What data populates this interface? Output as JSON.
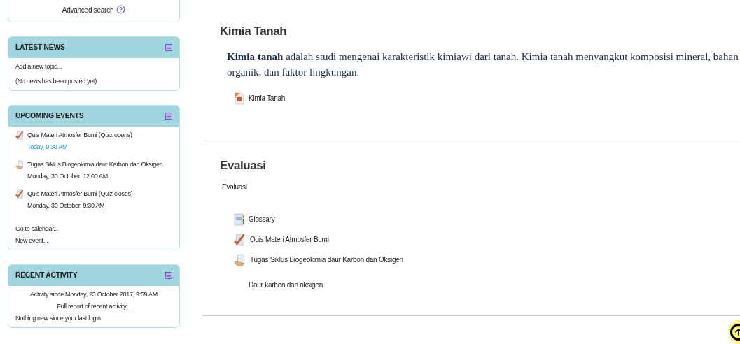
{
  "sidebar": {
    "search_link": "Advanced search",
    "blocks": [
      {
        "title": "LATEST NEWS",
        "items": [
          {
            "kind": "text",
            "text": "Add a new topic..."
          },
          {
            "kind": "text",
            "text": "(No news has been posted yet)"
          }
        ]
      },
      {
        "title": "UPCOMING EVENTS",
        "items": [
          {
            "kind": "quiz_event",
            "text": "Quis Materi Atmosfer Bumi (Quiz opens)",
            "time": "Today, 9:30 AM",
            "today": true
          },
          {
            "kind": "assignment_event",
            "text": "Tugas Siklus Biogeokimia daur Karbon dan Oksigen",
            "time": "Monday, 30 October, 12:00 AM",
            "today": false
          },
          {
            "kind": "quiz_event",
            "text": "Quis Materi Atmosfer Bumi (Quiz closes)",
            "time": "Monday, 30 October, 9:30 AM",
            "today": false
          },
          {
            "kind": "text",
            "text": "Go to calendar..."
          },
          {
            "kind": "text",
            "text": "New event..."
          }
        ]
      },
      {
        "title": "RECENT ACTIVITY",
        "items": [
          {
            "kind": "center",
            "text": "Activity since Monday, 23 October 2017, 9:59 AM"
          },
          {
            "kind": "center",
            "text": "Full report of recent activity..."
          },
          {
            "kind": "text",
            "text": "Nothing new since your last login"
          }
        ]
      }
    ]
  },
  "sections": [
    {
      "title": "Kimia Tanah",
      "paragraph": "**Kimia tanah** adalah studi mengenai karakteristik kimiawi dari tanah. Kimia tanah menyangkut komposisi mineral, bahan organik, dan faktor lingkungan.",
      "activities": [
        {
          "kind": "pdf",
          "label": "Kimia Tanah"
        }
      ]
    },
    {
      "title": "Evaluasi",
      "summary": "Evaluasi",
      "activities": [
        {
          "kind": "glossary",
          "label": "Glossary"
        },
        {
          "kind": "quiz",
          "label": "Quis Materi Atmosfer Bumi"
        },
        {
          "kind": "assignment",
          "label": "Tugas Siklus Biogeokimia daur Karbon dan Oksigen",
          "description": "Daur karbon dan oksigen"
        }
      ]
    }
  ]
}
